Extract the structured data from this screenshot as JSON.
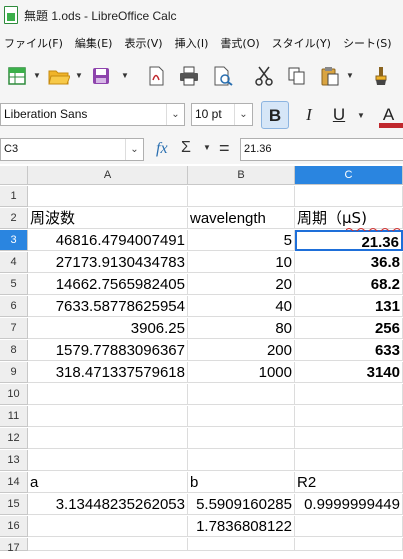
{
  "window": {
    "title": "無題 1.ods - LibreOffice Calc"
  },
  "menu": [
    "ファイル(F)",
    "編集(E)",
    "表示(V)",
    "挿入(I)",
    "書式(O)",
    "スタイル(Y)",
    "シート(S)"
  ],
  "format_bar": {
    "font_name": "Liberation Sans",
    "font_size": "10 pt",
    "bold": "B",
    "italic": "I",
    "underline": "U",
    "font_color": "A"
  },
  "formula_bar": {
    "name_box": "C3",
    "fx": "fx",
    "sigma": "Σ",
    "equals": "=",
    "content": "21.36"
  },
  "columns": [
    "A",
    "B",
    "C"
  ],
  "rows": [
    "1",
    "2",
    "3",
    "4",
    "5",
    "6",
    "7",
    "8",
    "9",
    "10",
    "11",
    "12",
    "13",
    "14",
    "15",
    "16",
    "17"
  ],
  "cells": {
    "A2": "周波数",
    "B2": "wavelength",
    "C2": "周期（μS)",
    "A3": "46816.4794007491",
    "B3": "5",
    "C3": "21.36",
    "A4": "27173.9130434783",
    "B4": "10",
    "C4": "36.8",
    "A5": "14662.7565982405",
    "B5": "20",
    "C5": "68.2",
    "A6": "7633.58778625954",
    "B6": "40",
    "C6": "131",
    "A7": "3906.25",
    "B7": "80",
    "C7": "256",
    "A8": "1579.77883096367",
    "B8": "200",
    "C8": "633",
    "A9": "318.471337579618",
    "B9": "1000",
    "C9": "3140",
    "A14": "a",
    "B14": "b",
    "C14": "R2",
    "A15": "3.13448235262053",
    "B15": "5.5909160285",
    "C15": "0.9999999449",
    "B16": "1.7836808122"
  },
  "colors": {
    "selection": "#1e6fd9",
    "selection_header": "#2a85e0",
    "selected_row_header": "#2a85e0",
    "font_color_bar": "#c0282d",
    "accent": "#3bb04a"
  }
}
